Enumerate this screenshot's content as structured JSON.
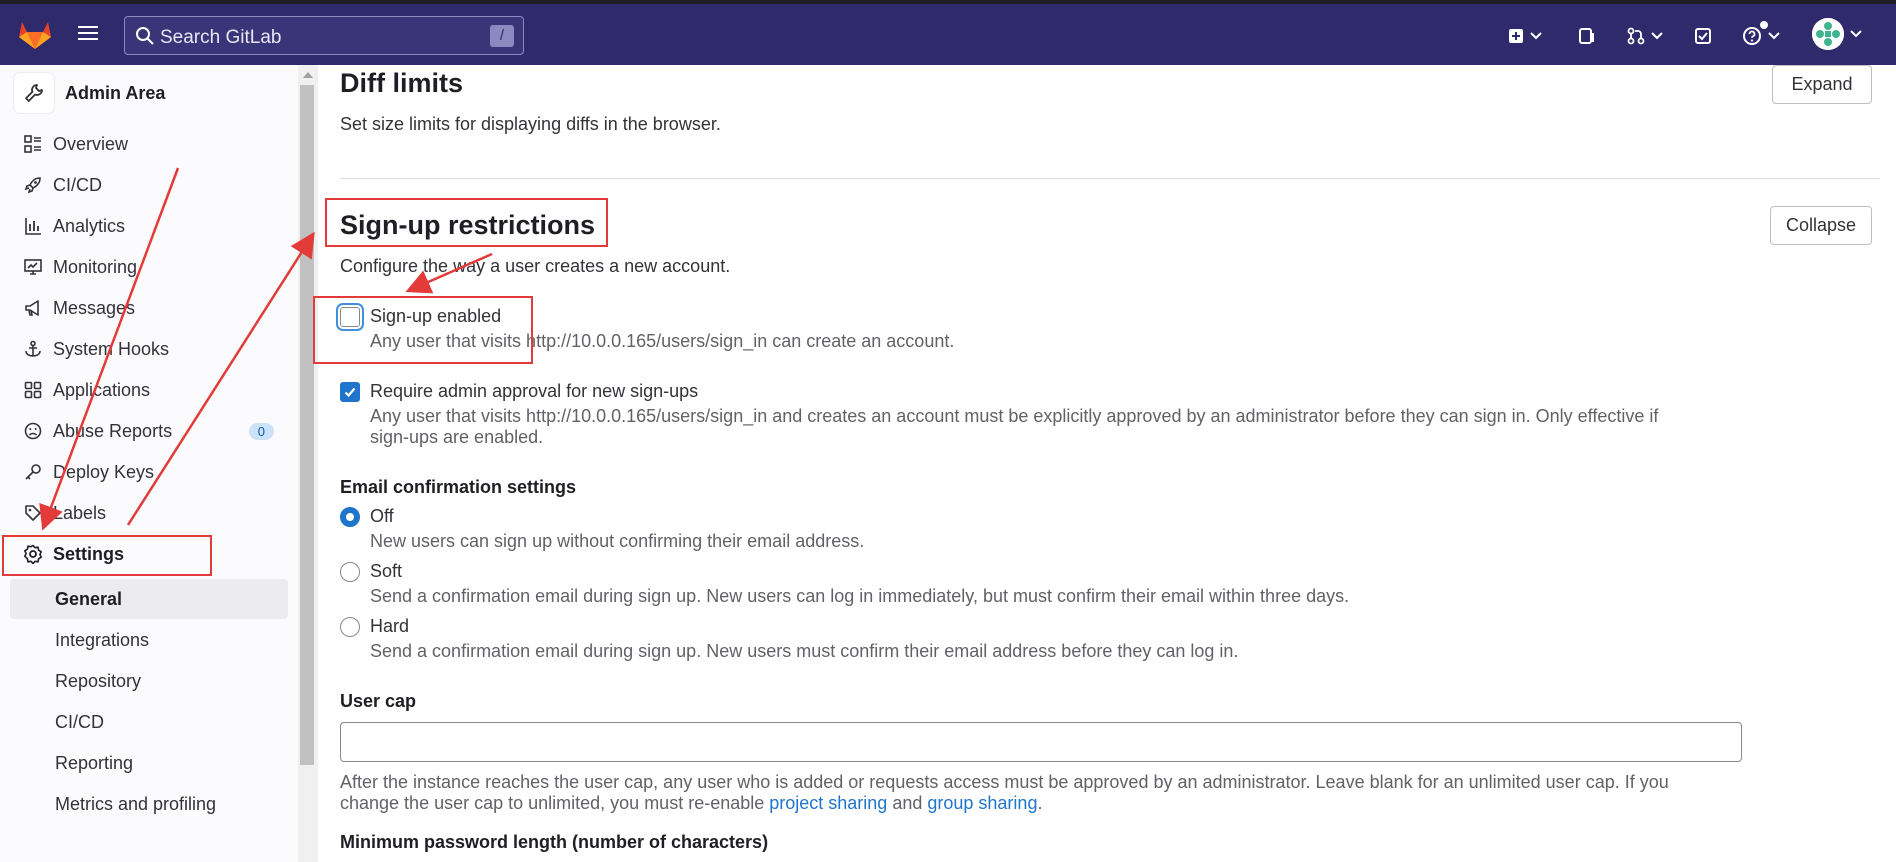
{
  "topbar": {
    "search_placeholder": "Search GitLab",
    "search_shortcut": "/",
    "icons": [
      "gitlab-logo-icon",
      "hamburger-icon",
      "search-icon",
      "new-icon",
      "issues-icon",
      "merge-requests-icon",
      "todo-icon",
      "help-icon",
      "avatar"
    ]
  },
  "sidebar": {
    "title": "Admin Area",
    "items": [
      {
        "label": "Overview",
        "icon": "overview-icon"
      },
      {
        "label": "CI/CD",
        "icon": "rocket-icon"
      },
      {
        "label": "Analytics",
        "icon": "chart-icon"
      },
      {
        "label": "Monitoring",
        "icon": "monitor-icon"
      },
      {
        "label": "Messages",
        "icon": "megaphone-icon"
      },
      {
        "label": "System Hooks",
        "icon": "anchor-icon"
      },
      {
        "label": "Applications",
        "icon": "grid-icon"
      },
      {
        "label": "Abuse Reports",
        "icon": "sad-face-icon",
        "count": "0"
      },
      {
        "label": "Deploy Keys",
        "icon": "key-icon"
      },
      {
        "label": "Labels",
        "icon": "label-icon"
      },
      {
        "label": "Settings",
        "icon": "gear-icon"
      }
    ],
    "sub_items": [
      "General",
      "Integrations",
      "Repository",
      "CI/CD",
      "Reporting",
      "Metrics and profiling"
    ]
  },
  "diff_limits": {
    "title": "Diff limits",
    "description": "Set size limits for displaying diffs in the browser.",
    "button": "Expand"
  },
  "signup": {
    "title": "Sign-up restrictions",
    "description": "Configure the way a user creates a new account.",
    "button": "Collapse",
    "signup_enabled_label": "Sign-up enabled",
    "signup_enabled_help": "Any user that visits http://10.0.0.165/users/sign_in can create an account.",
    "signup_enabled_checked": false,
    "approval_label": "Require admin approval for new sign-ups",
    "approval_help_1": "Any user that visits http://10.0.0.165/users/sign_in and creates an account must be explicitly approved by an administrator before they can sign in. Only effective if",
    "approval_help_2": "sign-ups are enabled.",
    "approval_checked": true,
    "email_confirmation_title": "Email confirmation settings",
    "email_options": [
      {
        "label": "Off",
        "help": "New users can sign up without confirming their email address.",
        "selected": true
      },
      {
        "label": "Soft",
        "help": "Send a confirmation email during sign up. New users can log in immediately, but must confirm their email within three days.",
        "selected": false
      },
      {
        "label": "Hard",
        "help": "Send a confirmation email during sign up. New users must confirm their email address before they can log in.",
        "selected": false
      }
    ],
    "user_cap_label": "User cap",
    "user_cap_value": "",
    "user_cap_help_1": "After the instance reaches the user cap, any user who is added or requests access must be approved by an administrator. Leave blank for an unlimited user cap. If you",
    "user_cap_help_2a": "change the user cap to unlimited, you must re-enable ",
    "user_cap_link_1": "project sharing",
    "user_cap_help_2b": " and ",
    "user_cap_link_2": "group sharing",
    "user_cap_help_2c": ".",
    "min_password_label": "Minimum password length (number of characters)"
  },
  "colors": {
    "topbar": "#2f2a6b",
    "accent": "#1f75cb",
    "annotation": "#e33a3a"
  }
}
